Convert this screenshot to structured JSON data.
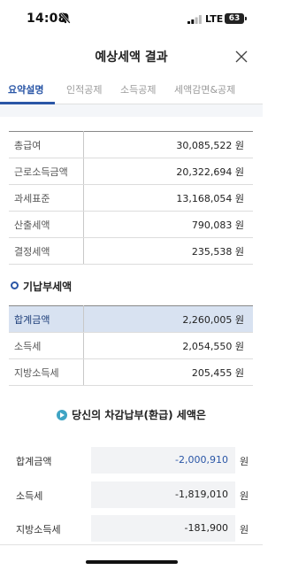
{
  "status_bar": {
    "time": "14:08",
    "network": "LTE",
    "battery": "63"
  },
  "header": {
    "title": "예상세액 결과"
  },
  "tabs": [
    {
      "label": "요약설명",
      "active": true
    },
    {
      "label": "인적공제",
      "active": false
    },
    {
      "label": "소득공제",
      "active": false
    },
    {
      "label": "세액감면&공제",
      "active": false
    }
  ],
  "summary_rows": [
    {
      "label": "총급여",
      "value": "30,085,522 원"
    },
    {
      "label": "근로소득금액",
      "value": "20,322,694 원"
    },
    {
      "label": "과세표준",
      "value": "13,168,054 원"
    },
    {
      "label": "산출세액",
      "value": "790,083 원"
    },
    {
      "label": "결정세액",
      "value": "235,538 원"
    }
  ],
  "prepaid": {
    "title": "기납부세액",
    "rows": [
      {
        "label": "합계금액",
        "value": "2,260,005 원"
      },
      {
        "label": "소득세",
        "value": "2,054,550 원"
      },
      {
        "label": "지방소득세",
        "value": "205,455 원"
      }
    ]
  },
  "result": {
    "title": "당신의 차감납부(환급) 세액은",
    "unit": "원",
    "rows": [
      {
        "label": "합계금액",
        "value": "-2,000,910"
      },
      {
        "label": "소득세",
        "value": "-1,819,010"
      },
      {
        "label": "지방소득세",
        "value": "-181,900"
      }
    ]
  },
  "colors": {
    "accent": "#2a56a6",
    "highlight_row": "#d8e2f1",
    "result_icon": "#3fa4c4"
  }
}
